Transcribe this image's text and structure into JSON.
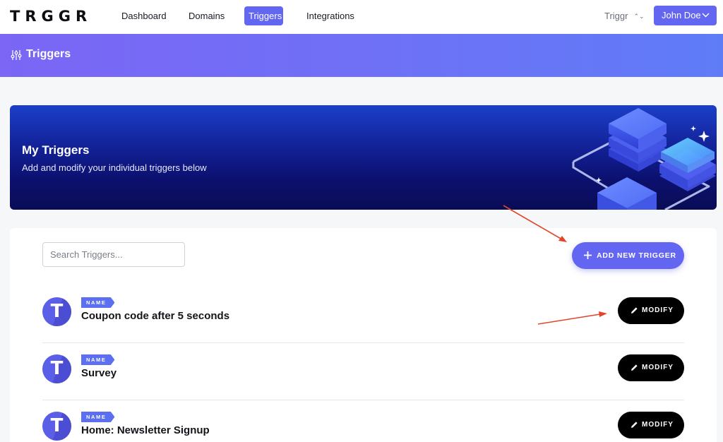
{
  "nav": {
    "logo": "TRGGR",
    "links": [
      "Dashboard",
      "Domains",
      "Triggers",
      "Integrations"
    ],
    "active_link": "Triggers",
    "org_select": "Triggr",
    "user_button": "John Doe"
  },
  "page_header": {
    "title": "Triggers",
    "icon": "sliders-icon"
  },
  "banner": {
    "title": "My Triggers",
    "subtitle": "Add and modify your individual triggers below",
    "illustration": "stacked-layers-illustration"
  },
  "triggers_panel": {
    "search_placeholder": "Search Triggers...",
    "search_value": "",
    "add_button": "ADD NEW TRIGGER",
    "rows": [
      {
        "tag": "NAME",
        "name": "Coupon code after 5 seconds",
        "action": "MODIFY"
      },
      {
        "tag": "NAME",
        "name": "Survey",
        "action": "MODIFY"
      },
      {
        "tag": "NAME",
        "name": "Home: Newsletter Signup",
        "action": "MODIFY"
      }
    ]
  },
  "colors": {
    "accent": "#6366f1",
    "banner_dark": "#0a0c55",
    "annotation_arrow": "#e2452b"
  }
}
